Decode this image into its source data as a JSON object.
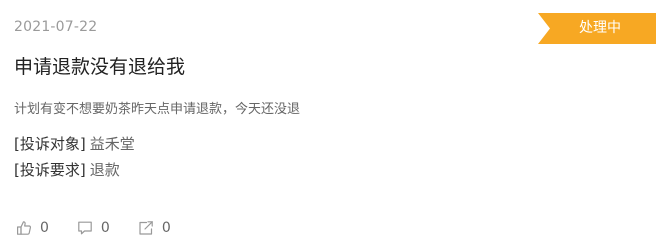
{
  "complaint": {
    "date": "2021-07-22",
    "status": "处理中",
    "title": "申请退款没有退给我",
    "description": "计划有变不想要奶茶昨天点申请退款，今天还没退",
    "target_label": "[投诉对象]",
    "target_value": "益禾堂",
    "request_label": "[投诉要求]",
    "request_value": "退款"
  },
  "actions": {
    "like_count": "0",
    "comment_count": "0",
    "share_count": "0"
  },
  "colors": {
    "status_badge": "#f7a823",
    "icon": "#999999"
  },
  "icons": {
    "like": "thumbs-up-icon",
    "comment": "comment-icon",
    "share": "share-icon"
  }
}
